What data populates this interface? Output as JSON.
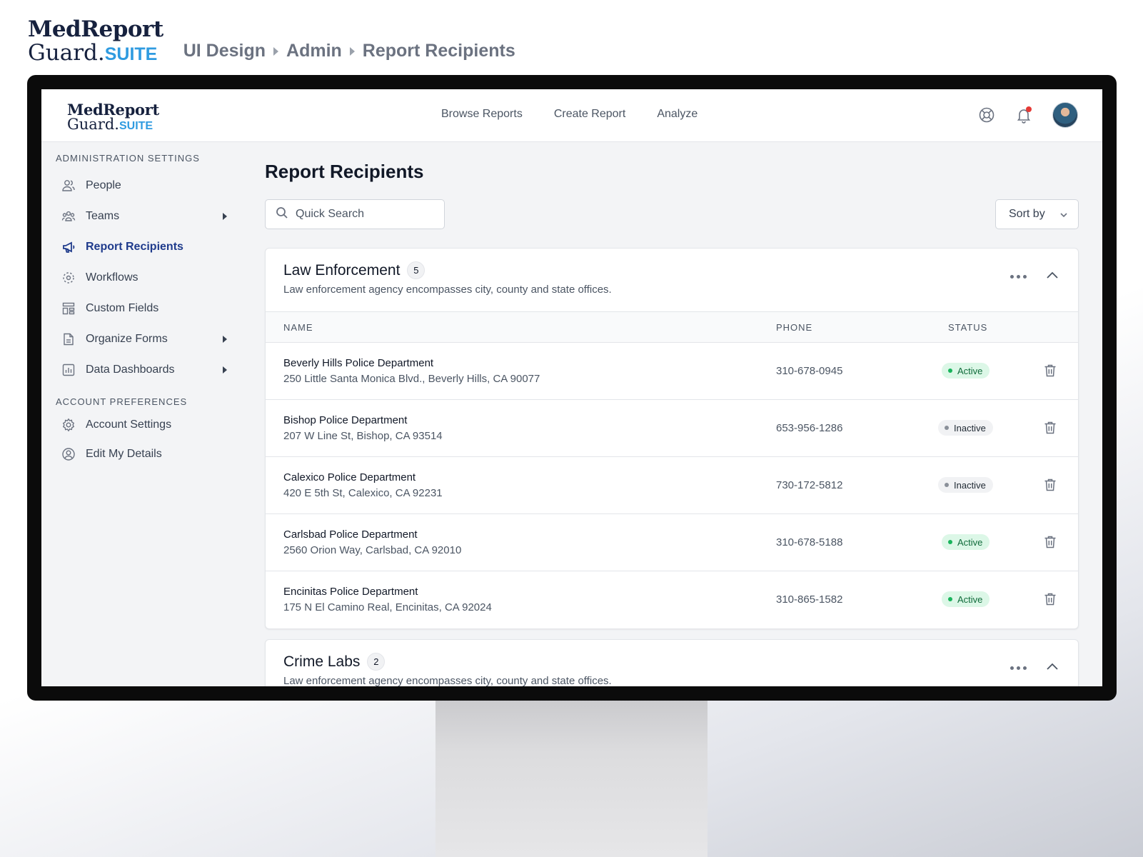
{
  "outer": {
    "brand_line1": "MedReport",
    "brand_line2": "Guard.",
    "brand_suite": "SUITE",
    "breadcrumb": [
      "UI Design",
      "Admin",
      "Report Recipients"
    ]
  },
  "header": {
    "brand_line1": "MedReport",
    "brand_line2": "Guard.",
    "brand_suite": "SUITE",
    "nav": [
      "Browse Reports",
      "Create Report",
      "Analyze"
    ],
    "icons": [
      "help-icon",
      "bell-icon",
      "avatar"
    ],
    "notification_dot_color": "#e53935"
  },
  "sidebar": {
    "admin_label": "ADMINISTRATION SETTINGS",
    "admin_items": [
      {
        "label": "People",
        "icon": "people-icon"
      },
      {
        "label": "Teams",
        "icon": "teams-icon"
      },
      {
        "label": "Report Recipients",
        "icon": "megaphone-icon"
      },
      {
        "label": "Workflows",
        "icon": "workflow-icon"
      },
      {
        "label": "Custom Fields",
        "icon": "custom-fields-icon"
      },
      {
        "label": "Organize Forms",
        "icon": "document-icon"
      },
      {
        "label": "Data Dashboards",
        "icon": "dashboard-icon"
      }
    ],
    "prefs_label": "ACCOUNT PREFERENCES",
    "pref_items": [
      {
        "label": "Account Settings",
        "icon": "gear-icon"
      },
      {
        "label": "Edit My Details",
        "icon": "user-circle-icon"
      }
    ],
    "active_color": "#1f3b8c"
  },
  "main": {
    "title": "Report Recipients",
    "search_placeholder": "Quick Search",
    "sort_label": "Sort by",
    "columns": {
      "name": "NAME",
      "phone": "PHONE",
      "status": "STATUS"
    },
    "groups": [
      {
        "title": "Law Enforcement",
        "count": "5",
        "description": "Law enforcement agency encompasses city, county and state offices.",
        "rows": [
          {
            "name": "Beverly Hills Police Department",
            "address": "250 Little Santa Monica Blvd., Beverly Hills, CA 90077",
            "phone": "310-678-0945",
            "status": "Active"
          },
          {
            "name": "Bishop Police Department",
            "address": "207 W Line St, Bishop, CA 93514",
            "phone": "653-956-1286",
            "status": "Inactive"
          },
          {
            "name": "Calexico Police Department",
            "address": "420 E 5th St, Calexico, CA 92231",
            "phone": "730-172-5812",
            "status": "Inactive"
          },
          {
            "name": "Carlsbad Police Department",
            "address": "2560 Orion Way, Carlsbad, CA 92010",
            "phone": "310-678-5188",
            "status": "Active"
          },
          {
            "name": "Encinitas Police Department",
            "address": "175 N El Camino Real, Encinitas, CA 92024",
            "phone": "310-865-1582",
            "status": "Active"
          }
        ]
      },
      {
        "title": "Crime Labs",
        "count": "2",
        "description": "Law enforcement agency encompasses city, county and state offices.",
        "rows": []
      }
    ],
    "status_colors": {
      "active": "#18b45b",
      "inactive": "#8a9099"
    }
  }
}
